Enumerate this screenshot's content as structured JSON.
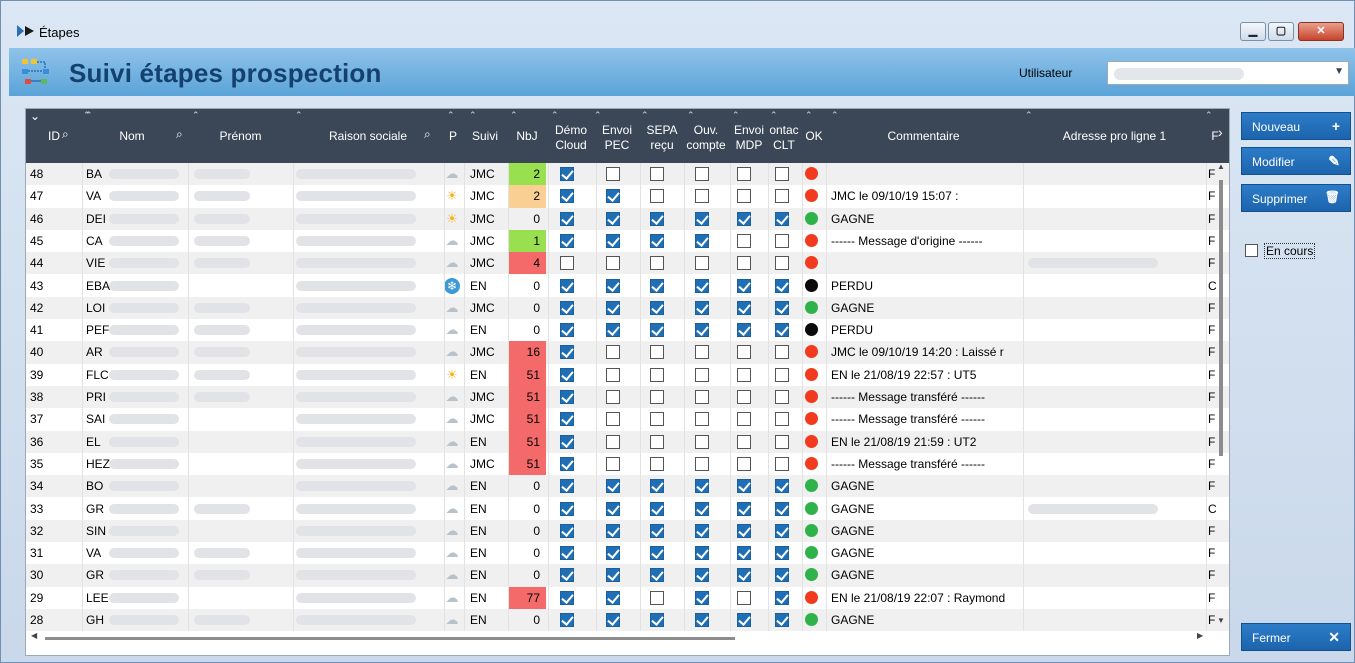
{
  "window": {
    "title": "Étapes",
    "minimize": "▁",
    "maximize": "▢",
    "close": "✕"
  },
  "header": {
    "title": "Suivi étapes prospection",
    "user_label": "Utilisateur"
  },
  "columns": [
    "ID",
    "Nom",
    "Prénom",
    "Raison sociale",
    "P",
    "Suivi",
    "NbJ",
    "Démo Cloud",
    "Envoi PEC",
    "SEPA reçu",
    "Ouv. compte",
    "Envoi MDP",
    "ontac CLT",
    "OK",
    "Commentaire",
    "Adresse pro ligne 1",
    "F"
  ],
  "colors": {
    "red": "#f23a1f",
    "green": "#2fb24a",
    "black": "#0a0a0a",
    "nbj_green": "#98e04f",
    "nbj_orange": "#f9cf93",
    "nbj_red": "#f46a6a",
    "header_bg": "#3b4756",
    "button_bg": "#1f69b3"
  },
  "rows": [
    {
      "id": "48",
      "nom": "BA",
      "weather": "cloud",
      "suivi": "JMC",
      "nbj": "2",
      "nbj_color": "green",
      "c": [
        1,
        0,
        0,
        0,
        0,
        0
      ],
      "ok": "red",
      "comment": "",
      "f": "F",
      "prenom_blur": 1,
      "rs_blur": 1,
      "addr_blur": 0
    },
    {
      "id": "47",
      "nom": "VA",
      "weather": "sun",
      "suivi": "JMC",
      "nbj": "2",
      "nbj_color": "orange",
      "c": [
        1,
        1,
        0,
        0,
        0,
        0
      ],
      "ok": "red",
      "comment": "JMC le 09/10/19 15:07 :",
      "f": "F",
      "prenom_blur": 1,
      "rs_blur": 1,
      "addr_blur": 0
    },
    {
      "id": "46",
      "nom": "DEI",
      "weather": "sun",
      "suivi": "JMC",
      "nbj": "0",
      "nbj_color": "",
      "c": [
        1,
        1,
        1,
        1,
        1,
        1
      ],
      "ok": "green",
      "comment": "GAGNE",
      "f": "F",
      "prenom_blur": 1,
      "rs_blur": 1,
      "addr_blur": 0
    },
    {
      "id": "45",
      "nom": "CA",
      "weather": "cloud",
      "suivi": "JMC",
      "nbj": "1",
      "nbj_color": "green",
      "c": [
        1,
        1,
        1,
        1,
        0,
        0
      ],
      "ok": "red",
      "comment": "------ Message d'origine ------",
      "f": "F",
      "prenom_blur": 1,
      "rs_blur": 1,
      "addr_blur": 0
    },
    {
      "id": "44",
      "nom": "VIE",
      "weather": "cloud",
      "suivi": "JMC",
      "nbj": "4",
      "nbj_color": "red",
      "c": [
        0,
        0,
        0,
        0,
        0,
        0
      ],
      "ok": "red",
      "comment": "",
      "f": "F",
      "prenom_blur": 1,
      "rs_blur": 1,
      "addr_blur": 1
    },
    {
      "id": "43",
      "nom": "EBA",
      "weather": "snow",
      "suivi": "EN",
      "nbj": "0",
      "nbj_color": "",
      "c": [
        1,
        1,
        1,
        1,
        1,
        1
      ],
      "ok": "black",
      "comment": "PERDU",
      "f": "C",
      "prenom_blur": 0,
      "rs_blur": 1,
      "addr_blur": 0
    },
    {
      "id": "42",
      "nom": "LOI",
      "weather": "cloud",
      "suivi": "JMC",
      "nbj": "0",
      "nbj_color": "",
      "c": [
        1,
        1,
        1,
        1,
        1,
        1
      ],
      "ok": "green",
      "comment": "GAGNE",
      "f": "F",
      "prenom_blur": 1,
      "rs_blur": 1,
      "addr_blur": 0
    },
    {
      "id": "41",
      "nom": "PEF",
      "weather": "cloud",
      "suivi": "EN",
      "nbj": "0",
      "nbj_color": "",
      "c": [
        1,
        1,
        1,
        1,
        1,
        1
      ],
      "ok": "black",
      "comment": "PERDU",
      "f": "F",
      "prenom_blur": 1,
      "rs_blur": 1,
      "addr_blur": 0
    },
    {
      "id": "40",
      "nom": "AR",
      "weather": "cloud",
      "suivi": "JMC",
      "nbj": "16",
      "nbj_color": "red",
      "c": [
        1,
        0,
        0,
        0,
        0,
        0
      ],
      "ok": "red",
      "comment": "JMC le 09/10/19 14:20 : Laissé r",
      "f": "F",
      "prenom_blur": 1,
      "rs_blur": 1,
      "addr_blur": 0
    },
    {
      "id": "39",
      "nom": "FLC",
      "weather": "sun",
      "suivi": "EN",
      "nbj": "51",
      "nbj_color": "red",
      "c": [
        1,
        0,
        0,
        0,
        0,
        0
      ],
      "ok": "red",
      "comment": "EN le 21/08/19 22:57 : UT5",
      "f": "F",
      "prenom_blur": 1,
      "rs_blur": 1,
      "addr_blur": 0
    },
    {
      "id": "38",
      "nom": "PRI",
      "weather": "cloud",
      "suivi": "JMC",
      "nbj": "51",
      "nbj_color": "red",
      "c": [
        1,
        0,
        0,
        0,
        0,
        0
      ],
      "ok": "red",
      "comment": "------ Message transféré ------",
      "f": "F",
      "prenom_blur": 1,
      "rs_blur": 1,
      "addr_blur": 0
    },
    {
      "id": "37",
      "nom": "SAI",
      "weather": "cloud",
      "suivi": "JMC",
      "nbj": "51",
      "nbj_color": "red",
      "c": [
        1,
        0,
        0,
        0,
        0,
        0
      ],
      "ok": "red",
      "comment": "------ Message transféré ------",
      "f": "F",
      "prenom_blur": 0,
      "rs_blur": 1,
      "addr_blur": 0
    },
    {
      "id": "36",
      "nom": "EL",
      "weather": "cloud",
      "suivi": "EN",
      "nbj": "51",
      "nbj_color": "red",
      "c": [
        1,
        0,
        0,
        0,
        0,
        0
      ],
      "ok": "red",
      "comment": "EN le 21/08/19 21:59 : UT2",
      "f": "F",
      "prenom_blur": 0,
      "rs_blur": 1,
      "addr_blur": 0
    },
    {
      "id": "35",
      "nom": "HEZ",
      "weather": "cloud",
      "suivi": "JMC",
      "nbj": "51",
      "nbj_color": "red",
      "c": [
        1,
        0,
        0,
        0,
        0,
        0
      ],
      "ok": "red",
      "comment": "------ Message transféré ------",
      "f": "F",
      "prenom_blur": 0,
      "rs_blur": 1,
      "addr_blur": 0
    },
    {
      "id": "34",
      "nom": "BO",
      "weather": "cloud",
      "suivi": "EN",
      "nbj": "0",
      "nbj_color": "",
      "c": [
        1,
        1,
        1,
        1,
        1,
        1
      ],
      "ok": "green",
      "comment": "GAGNE",
      "f": "F",
      "prenom_blur": 0,
      "rs_blur": 1,
      "addr_blur": 0
    },
    {
      "id": "33",
      "nom": "GR",
      "weather": "cloud",
      "suivi": "EN",
      "nbj": "0",
      "nbj_color": "",
      "c": [
        1,
        1,
        1,
        1,
        1,
        1
      ],
      "ok": "green",
      "comment": "GAGNE",
      "f": "C",
      "prenom_blur": 1,
      "rs_blur": 1,
      "addr_blur": 1
    },
    {
      "id": "32",
      "nom": "SIN",
      "weather": "cloud",
      "suivi": "EN",
      "nbj": "0",
      "nbj_color": "",
      "c": [
        1,
        1,
        1,
        1,
        1,
        1
      ],
      "ok": "green",
      "comment": "GAGNE",
      "f": "F",
      "prenom_blur": 0,
      "rs_blur": 1,
      "addr_blur": 0
    },
    {
      "id": "31",
      "nom": "VA",
      "weather": "cloud",
      "suivi": "EN",
      "nbj": "0",
      "nbj_color": "",
      "c": [
        1,
        1,
        1,
        1,
        1,
        1
      ],
      "ok": "green",
      "comment": "GAGNE",
      "f": "F",
      "prenom_blur": 1,
      "rs_blur": 1,
      "addr_blur": 0
    },
    {
      "id": "30",
      "nom": "GR",
      "weather": "cloud",
      "suivi": "EN",
      "nbj": "0",
      "nbj_color": "",
      "c": [
        1,
        1,
        1,
        1,
        1,
        1
      ],
      "ok": "green",
      "comment": "GAGNE",
      "f": "F",
      "prenom_blur": 1,
      "rs_blur": 1,
      "addr_blur": 0
    },
    {
      "id": "29",
      "nom": "LEE",
      "weather": "cloud",
      "suivi": "EN",
      "nbj": "77",
      "nbj_color": "red",
      "c": [
        1,
        1,
        0,
        1,
        0,
        1
      ],
      "ok": "red",
      "comment": "EN le 21/08/19 22:07 : Raymond",
      "f": "F",
      "prenom_blur": 0,
      "rs_blur": 1,
      "addr_blur": 0
    },
    {
      "id": "28",
      "nom": "GH",
      "weather": "cloud",
      "suivi": "EN",
      "nbj": "0",
      "nbj_color": "",
      "c": [
        1,
        1,
        1,
        1,
        1,
        1
      ],
      "ok": "green",
      "comment": "GAGNE",
      "f": "F",
      "prenom_blur": 1,
      "rs_blur": 1,
      "addr_blur": 0
    }
  ],
  "sidebar": {
    "nouveau": "Nouveau",
    "modifier": "Modifier",
    "supprimer": "Supprimer",
    "en_cours": "En cours",
    "fermer": "Fermer"
  },
  "icons": {
    "search": "magnifier-icon",
    "sun": "sun-icon",
    "cloud": "cloud-icon",
    "snow": "snowflake-icon",
    "plus": "plus-icon",
    "pencil": "pencil-icon",
    "trash": "trash-icon",
    "close": "close-icon"
  }
}
